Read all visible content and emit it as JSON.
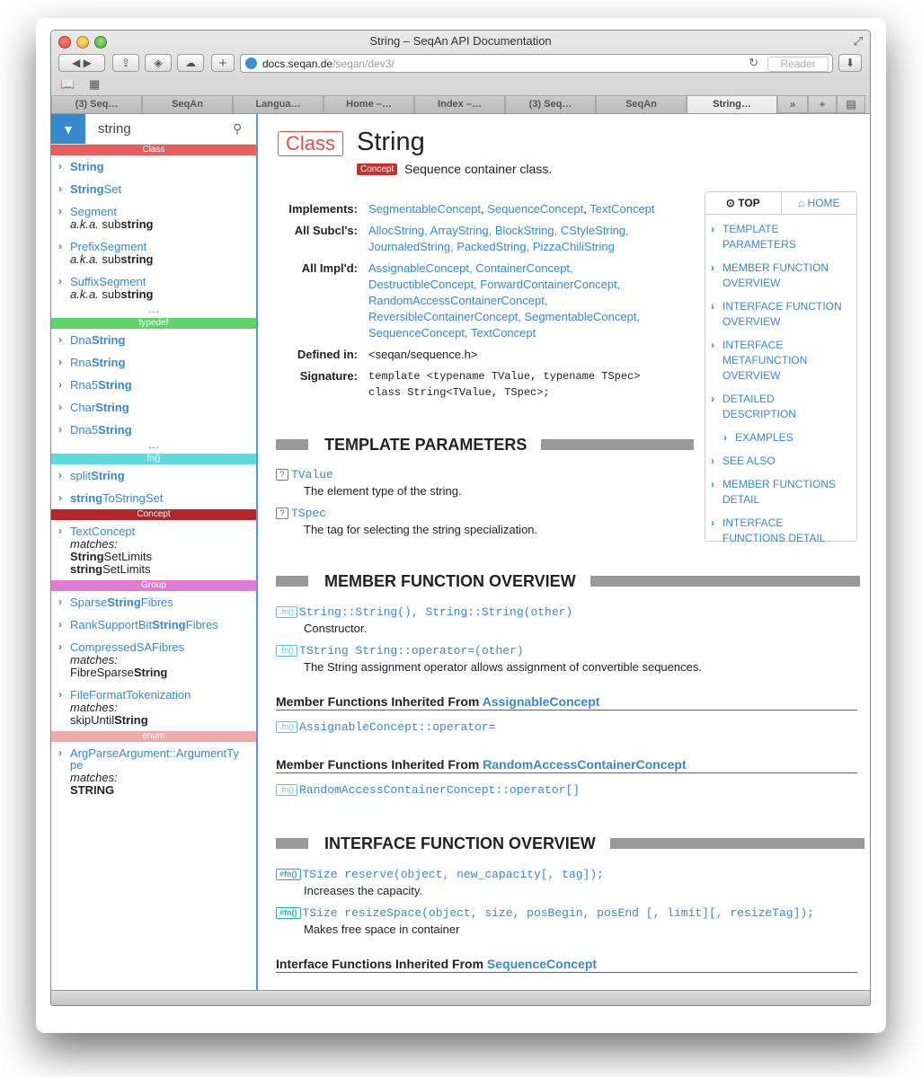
{
  "window": {
    "title": "String – SeqAn API Documentation"
  },
  "browser": {
    "url_host": "docs.seqan.de",
    "url_path": "/seqan/dev3/",
    "reader": "Reader",
    "tabs": [
      "(3) Seq…",
      "SeqAn",
      "Langua…",
      "Home –…",
      "Index –…",
      "(3) Seq…",
      "SeqAn",
      "String…"
    ],
    "active_tab": 7
  },
  "sidebar": {
    "search_value": "string",
    "headers": {
      "class": "Class",
      "typedef": "typedef",
      "fn": "fn()",
      "concept": "Concept",
      "group": "Group",
      "enum": "enum"
    },
    "header_colors": {
      "class": "#e35e5e",
      "typedef": "#5fd36b",
      "fn": "#5fd9dd",
      "concept": "#b5262a",
      "group": "#e07ad4",
      "enum": "#efaaaa"
    },
    "more": "…",
    "class_items": [
      {
        "pre": "",
        "bold": "String",
        "post": ""
      },
      {
        "pre": "",
        "bold": "String",
        "post": "Set"
      },
      {
        "pre": "Segment",
        "bold": "",
        "post": "",
        "aka": "a.k.a.",
        "aka_pre": "sub",
        "aka_bold": "string"
      },
      {
        "pre": "PrefixSegment",
        "bold": "",
        "post": "",
        "aka": "a.k.a.",
        "aka_pre": "sub",
        "aka_bold": "string"
      },
      {
        "pre": "SuffixSegment",
        "bold": "",
        "post": "",
        "aka": "a.k.a.",
        "aka_pre": "sub",
        "aka_bold": "string"
      }
    ],
    "typedef_items": [
      {
        "pre": "Dna",
        "bold": "String"
      },
      {
        "pre": "Rna",
        "bold": "String"
      },
      {
        "pre": "Rna5",
        "bold": "String"
      },
      {
        "pre": "Char",
        "bold": "String"
      },
      {
        "pre": "Dna5",
        "bold": "String"
      }
    ],
    "fn_items": [
      {
        "pre": "split",
        "bold": "String",
        "post": ""
      },
      {
        "pre": "",
        "bold": "string",
        "post": "ToStringSet"
      }
    ],
    "concept_item": {
      "label": "TextConcept",
      "matches": "matches:",
      "m1_bold": "String",
      "m1_post": "SetLimits",
      "m2_bold": "string",
      "m2_post": "SetLimits"
    },
    "group_items": [
      {
        "pre": "Sparse",
        "bold": "String",
        "post": "Fibres"
      },
      {
        "pre": "RankSupportBit",
        "bold": "String",
        "post": "Fibres"
      },
      {
        "pre": "CompressedSAFibres",
        "bold": "",
        "post": "",
        "matches": "matches:",
        "m_pre": "FibreSparse",
        "m_bold": "String"
      },
      {
        "pre": "FileFormatTokenization",
        "bold": "",
        "post": "",
        "matches": "matches:",
        "m_pre": "skipUntil",
        "m_bold": "String"
      }
    ],
    "enum_item": {
      "line1": "ArgParseArgument::ArgumentTy",
      "line2": "pe",
      "matches": "matches:",
      "m_bold": "STRING"
    }
  },
  "page": {
    "kind": "Class",
    "name": "String",
    "concept_badge": "Concept",
    "brief": "Sequence container class.",
    "implements_label": "Implements:",
    "implements": [
      "SegmentableConcept",
      ", ",
      "SequenceConcept",
      ", ",
      "TextConcept"
    ],
    "subcl_label": "All Subcl's:",
    "subcl_1": "AllocString, ArrayString, BlockString, CStyleString,",
    "subcl_2": "JournaledString, PackedString, PizzaChiliString",
    "impl_label": "All Impl'd:",
    "impl_1": "AssignableConcept, ContainerConcept,",
    "impl_2": "DestructibleConcept, ForwardContainerConcept,",
    "impl_3": "RandomAccessContainerConcept,",
    "impl_4": "ReversibleContainerConcept, SegmentableConcept,",
    "impl_5": "SequenceConcept, TextConcept",
    "defined_label": "Defined in:",
    "defined": "<seqan/sequence.h>",
    "sig_label": "Signature:",
    "sig_1": "template <typename TValue, typename TSpec>",
    "sig_2": "class String<TValue, TSpec>;"
  },
  "toc": {
    "top": "TOP",
    "home": "HOME",
    "items": [
      {
        "l1": "TEMPLATE",
        "l2": "PARAMETERS"
      },
      {
        "l1": "MEMBER FUNCTION",
        "l2": "OVERVIEW"
      },
      {
        "l1": "INTERFACE FUNCTION",
        "l2": "OVERVIEW"
      },
      {
        "l1": "INTERFACE",
        "l2": "METAFUNCTION",
        "l3": "OVERVIEW"
      },
      {
        "l1": "DETAILED",
        "l2": "DESCRIPTION"
      },
      {
        "l1": "EXAMPLES"
      },
      {
        "l1": "SEE ALSO"
      },
      {
        "l1": "MEMBER FUNCTIONS",
        "l2": "DETAIL"
      },
      {
        "l1": "INTERFACE",
        "l2": "FUNCTIONS DETAIL"
      }
    ]
  },
  "sections": {
    "template_params": "TEMPLATE PARAMETERS",
    "member_fn": "MEMBER FUNCTION OVERVIEW",
    "iface_fn": "INTERFACE FUNCTION OVERVIEW"
  },
  "params": [
    {
      "badge": "?",
      "name": "TValue",
      "desc": "The element type of the string."
    },
    {
      "badge": "?",
      "name": "TSpec",
      "desc": "The tag for selecting the string specialization."
    }
  ],
  "members": [
    {
      "badge": ".fn()",
      "sig": "String::String(), String::String(other)",
      "desc": "Constructor."
    },
    {
      "badge": ".fn()",
      "sig": "TString String::operator=(other)",
      "desc": "The String assignment operator allows assignment of convertible sequences."
    }
  ],
  "inherited": [
    {
      "label": "Member Functions Inherited From",
      "from": "AssignableConcept",
      "badge": ".fn()",
      "sig": "AssignableConcept::operator="
    },
    {
      "label": "Member Functions Inherited From",
      "from": "RandomAccessContainerConcept",
      "badge": ".fn()",
      "sig": "RandomAccessContainerConcept::operator[]"
    }
  ],
  "iface": [
    {
      "badge": "#fn()",
      "sig": "TSize reserve(object, new_capacity[, tag]);",
      "desc": "Increases the capacity."
    },
    {
      "badge": "#fn()",
      "sig": "TSize resizeSpace(object, size, posBegin, posEnd [, limit][, resizeTag]);",
      "desc": "Makes free space in container"
    }
  ],
  "iface_inherited": {
    "label": "Interface Functions Inherited From",
    "from": "SequenceConcept"
  }
}
